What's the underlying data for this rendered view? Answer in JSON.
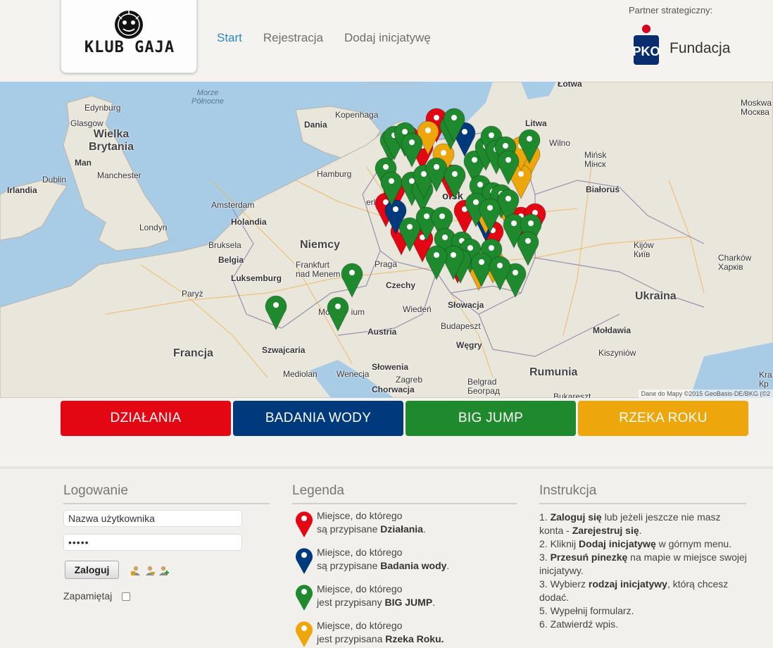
{
  "header": {
    "logo_text": "KLUB GAJA",
    "nav": [
      {
        "label": "Start",
        "active": true
      },
      {
        "label": "Rejestracja",
        "active": false
      },
      {
        "label": "Dodaj inicjatywę",
        "active": false
      }
    ],
    "partner_label": "Partner strategiczny:",
    "partner_name": "Fundacja"
  },
  "map": {
    "labels": {
      "sea": "Morze\nPółnocne",
      "edinburgh": "Edynburg",
      "glasgow": "Glasgow",
      "great_britain": "Wielka\nBrytania",
      "man": "Man",
      "manchester": "Manchester",
      "dublin": "Dublin",
      "ireland": "Irlandia",
      "london": "Londyn",
      "amsterdam": "Amsterdam",
      "netherlands": "Holandia",
      "brussels": "Bruksela",
      "belgium": "Belgia",
      "luxembourg": "Luksemburg",
      "paris": "Paryż",
      "france": "Francja",
      "switzerland": "Szwajcaria",
      "milan": "Mediolan",
      "venice": "Wenecja",
      "copenhagen": "Kopenhaga",
      "denmark": "Dania",
      "hamburg": "Hamburg",
      "berlin": "erlin",
      "germany": "Niemcy",
      "frankfurt": "Frankfurt\nnad Menem",
      "munich": "Mo         ium",
      "prague": "Praga",
      "czechia": "Czechy",
      "vienna": "Wiedeń",
      "austria": "Austria",
      "slovenia": "Słowenia",
      "zagreb": "Zagreb",
      "croatia": "Chorwacja",
      "slovakia": "Słowacja",
      "budapest": "Budapeszt",
      "hungary": "Węgry",
      "belgrade": "Belgrad\nБеоград",
      "romania": "Rumunia",
      "bucharest": "Bukareszt",
      "poland": "olsk",
      "latvia": "Łotwa",
      "lithuania": "Litwa",
      "vilnius": "Wilno",
      "minsk": "Mińsk\nМінск",
      "belarus": "Białoruś",
      "moscow": "Moskwa\nМосква",
      "kyiv": "Kijów\nКиїв",
      "kharkiv": "Charków\nХарків",
      "ukraine": "Ukraina",
      "moldova": "Mołdawia",
      "chisinau": "Kiszyniów",
      "krym": "Kra\nКр"
    },
    "attribution": "Dane do Mapy ©2015 GeoBasis-DE/BKG (©2"
  },
  "categories": [
    {
      "label": "DZIAŁANIA",
      "color": "#e30613"
    },
    {
      "label": "BADANIA WODY",
      "color": "#003a7d"
    },
    {
      "label": "BIG JUMP",
      "color": "#1f8a2d"
    },
    {
      "label": "RZEKA ROKU",
      "color": "#eda70c"
    }
  ],
  "login": {
    "title": "Logowanie",
    "username_value": "Nazwa użytkownika",
    "password_value": "•••••",
    "button": "Zaloguj",
    "remember": "Zapamiętaj",
    "icons": [
      "lock-user-icon",
      "user-key-icon",
      "add-user-icon"
    ]
  },
  "legend": {
    "title": "Legenda",
    "items": [
      {
        "line1": "Miejsce, do którego",
        "line2_pre": "są przypisane ",
        "line2_bold": "Działania",
        "line2_post": ".",
        "color": "#e30613"
      },
      {
        "line1": "Miejsce, do którego",
        "line2_pre": "są przypisane ",
        "line2_bold": "Badania wody",
        "line2_post": ".",
        "color": "#003a7d"
      },
      {
        "line1": "Miejsce, do którego",
        "line2_pre": "jest przypisany ",
        "line2_bold": "BIG JUMP",
        "line2_post": ".",
        "color": "#1f8a2d"
      },
      {
        "line1": "Miejsce, do którego",
        "line2_pre": "jest przypisana ",
        "line2_bold": "Rzeka Roku.",
        "line2_post": "",
        "color": "#eda70c"
      }
    ]
  },
  "instructions": {
    "title": "Instrukcja",
    "s1_pre": "1. ",
    "s1_b1": "Zaloguj się",
    "s1_mid": " lub jeżeli jeszcze nie masz konta - ",
    "s1_b2": "Zarejestruj się",
    "s1_post": ".",
    "s2_pre": "2. Kliknij ",
    "s2_b": "Dodaj inicjatywę",
    "s2_post": " w górnym menu.",
    "s3_pre": "3. ",
    "s3_b": "Przesuń pinezkę",
    "s3_post": " na mapie w miejsce swojej inicjatywy.",
    "s4_pre": "3. Wybierz ",
    "s4_b": "rodzaj inicjatywy",
    "s4_post": ", którą chcesz dodać.",
    "s5": "5. Wypełnij formularz.",
    "s6": "6. Zatwierdź wpis."
  }
}
